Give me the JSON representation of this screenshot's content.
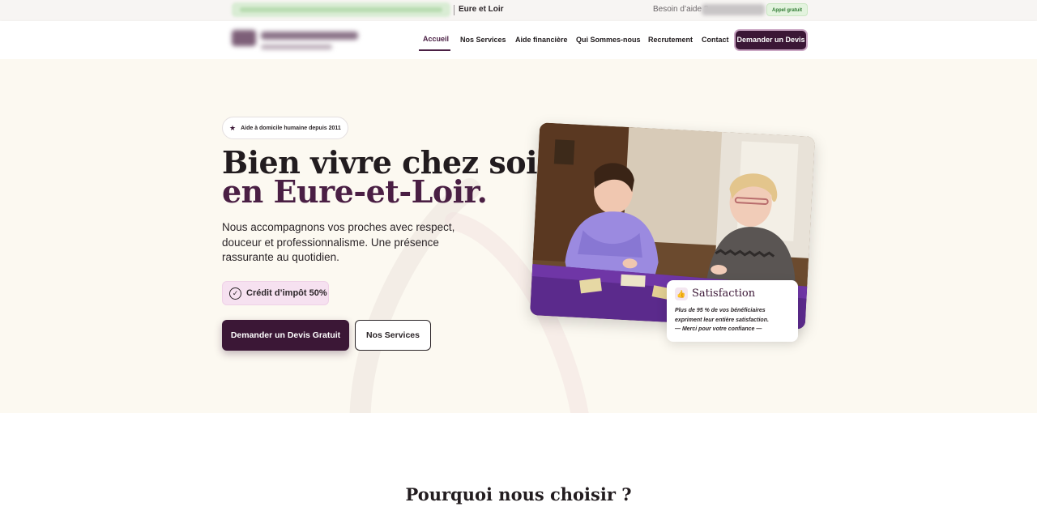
{
  "topbar": {
    "region": "Eure et Loir",
    "help_text": "Besoin d’aide ?",
    "free_call": "Appel gratuit"
  },
  "nav": {
    "items": [
      {
        "label": "Accueil",
        "active": true
      },
      {
        "label": "Nos Services"
      },
      {
        "label": "Aide financière"
      },
      {
        "label": "Qui Sommes-nous"
      },
      {
        "label": "Recrutement"
      },
      {
        "label": "Contact"
      }
    ],
    "cta": "Demander un Devis"
  },
  "hero": {
    "badge": "Aide à domicile humaine depuis 2011",
    "title_line1": "Bien vivre chez soi",
    "title_line2": "en Eure-et-Loir.",
    "lead": "Nous accompagnons vos proches avec respect, douceur et professionnalisme. Une présence rassurante au quotidien.",
    "credit": "Crédit d’impôt 50%",
    "btn_primary": "Demander un Devis Gratuit",
    "btn_secondary": "Nos Services"
  },
  "satisfaction": {
    "title": "Satisfaction",
    "line1": "Plus de 95 % de vos bénéficiaires",
    "line2": "expriment leur entière satisfaction.",
    "line3": "— Merci pour votre confiance —"
  },
  "section": {
    "title": "Pourquoi nous choisir ?"
  },
  "colors": {
    "brand": "#3b1736",
    "brand_accent": "#4a1f44",
    "hero_bg": "#fcf9f1",
    "credit_bg": "#f6e1f0"
  }
}
